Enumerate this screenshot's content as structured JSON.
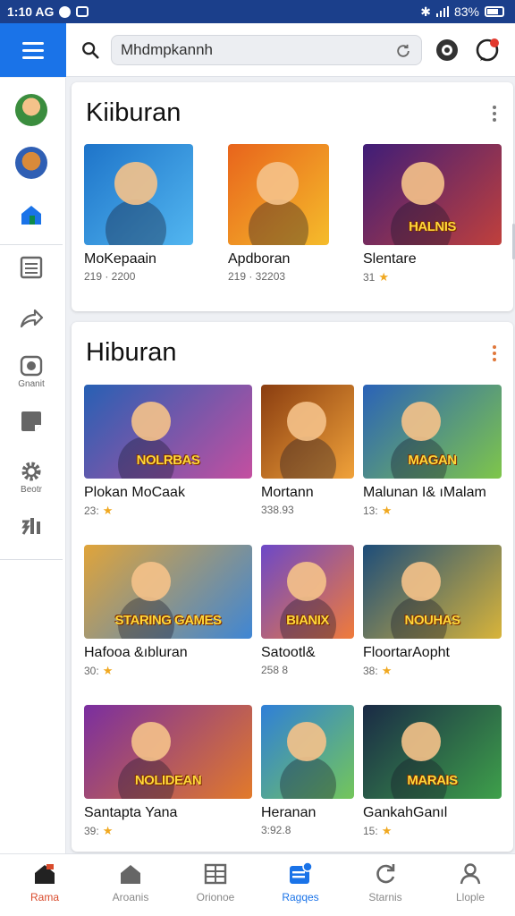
{
  "status": {
    "time": "1:10 AG",
    "battery": "83%"
  },
  "search": {
    "value": "Mhdmpkannh",
    "placeholder": ""
  },
  "rail": {
    "labels": [
      "Gnanit",
      "Beotr"
    ]
  },
  "sections": [
    {
      "title": "Kiiburan",
      "items": [
        {
          "name": "MoKepaain",
          "meta": "219 · 2200",
          "rating": "",
          "caption": "",
          "colors": [
            "#1e74c9",
            "#52b6f0"
          ]
        },
        {
          "name": "Apdboran",
          "meta": "219 · 32203",
          "rating": "",
          "caption": "",
          "colors": [
            "#e8641c",
            "#f5bc2b"
          ]
        },
        {
          "name": "Slentare",
          "meta": "31",
          "rating": "★",
          "caption": "HALNIS",
          "colors": [
            "#3f1d78",
            "#c0403c"
          ]
        }
      ]
    },
    {
      "title": "Hiburan",
      "items": [
        {
          "name": "Plokan MoCaak",
          "meta": "23:",
          "rating": "★",
          "caption": "NOLRBAS",
          "colors": [
            "#2760b4",
            "#c44fa0"
          ]
        },
        {
          "name": "Mortann",
          "meta": "338.93",
          "rating": "",
          "caption": "",
          "colors": [
            "#8a3d10",
            "#f0a23a"
          ]
        },
        {
          "name": "Malunan I& ıMalam",
          "meta": "13:",
          "rating": "★",
          "caption": "MAGAN",
          "colors": [
            "#2a62b8",
            "#7fc64a"
          ]
        },
        {
          "name": "Hafooa &ıbluran",
          "meta": "30:",
          "rating": "★",
          "caption": "STARING GAMES",
          "colors": [
            "#e0a43a",
            "#3f86d4"
          ]
        },
        {
          "name": "Satootl&",
          "meta": "258 8",
          "rating": "",
          "caption": "BIANIX",
          "colors": [
            "#6c48c8",
            "#f07b3a"
          ]
        },
        {
          "name": "FloortarAopht",
          "meta": "38:",
          "rating": "★",
          "caption": "NOUHAS",
          "colors": [
            "#1d4d7a",
            "#d8b43a"
          ]
        },
        {
          "name": "Santapta Yana",
          "meta": "39:",
          "rating": "★",
          "caption": "NOLIDEAN",
          "colors": [
            "#7a2ea0",
            "#e27a2a"
          ]
        },
        {
          "name": "Heranan",
          "meta": "3:92.8",
          "rating": "",
          "caption": "",
          "colors": [
            "#2f7fd8",
            "#74c65a"
          ]
        },
        {
          "name": "GankahGanıl",
          "meta": "15:",
          "rating": "★",
          "caption": "MARAIS",
          "colors": [
            "#1a2a46",
            "#3ea04a"
          ]
        }
      ]
    }
  ],
  "bottom_nav": [
    {
      "label": "Rama"
    },
    {
      "label": "Aroanis"
    },
    {
      "label": "Orionoe"
    },
    {
      "label": "Ragqes"
    },
    {
      "label": "Starnis"
    },
    {
      "label": "Llople"
    }
  ],
  "colors": {
    "accent": "#1a73e8",
    "status_bar": "#1b3f8b",
    "active_nav": "#d94a2b",
    "star": "#f0a820"
  }
}
